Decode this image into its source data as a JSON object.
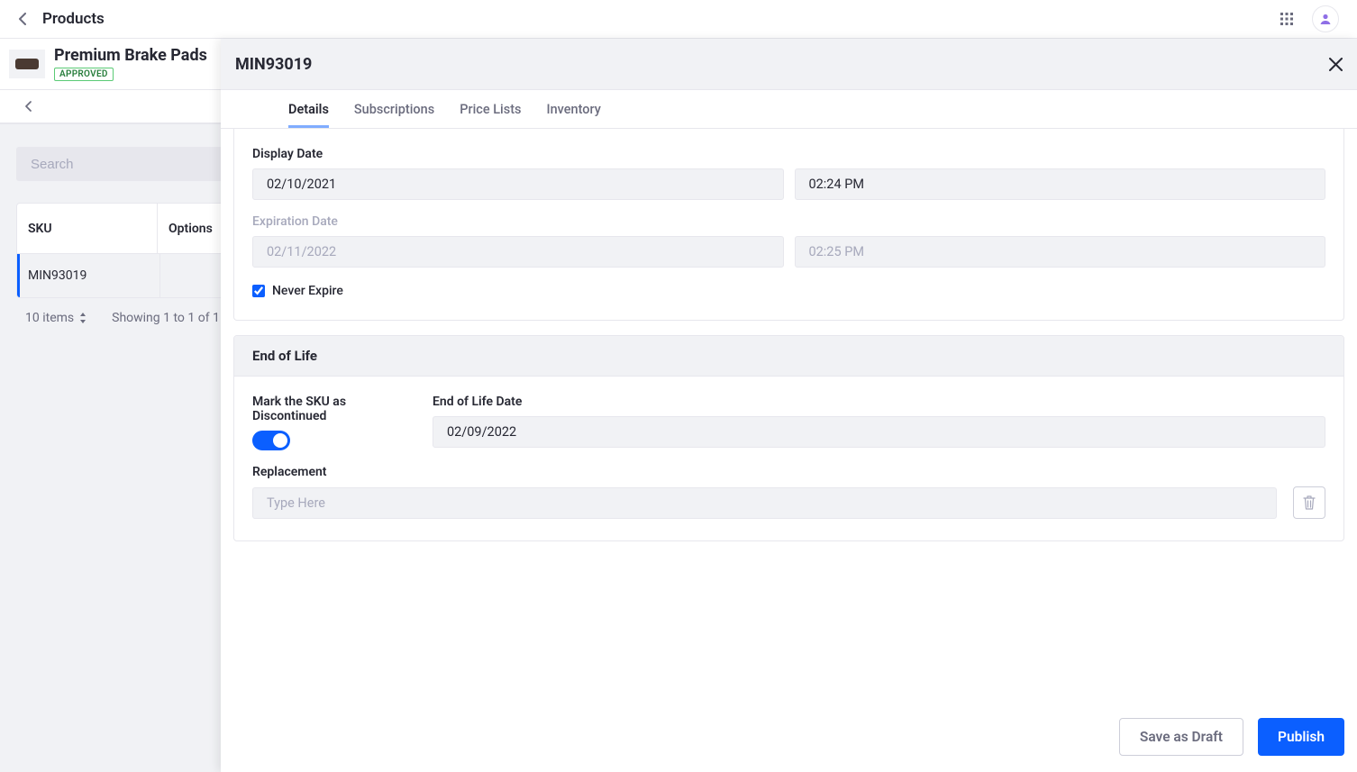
{
  "top": {
    "breadcrumb": "Products"
  },
  "product": {
    "name": "Premium Brake Pads",
    "status_badge": "APPROVED"
  },
  "left": {
    "search_placeholder": "Search",
    "columns": {
      "sku": "SKU",
      "options": "Options"
    },
    "row_sku": "MIN93019",
    "pager_items": "10 items",
    "pager_showing": "Showing 1 to 1 of 1"
  },
  "panel": {
    "title": "MIN93019",
    "tabs": {
      "details": "Details",
      "subscriptions": "Subscriptions",
      "price_lists": "Price Lists",
      "inventory": "Inventory"
    },
    "display_date": {
      "label": "Display Date",
      "date": "02/10/2021",
      "time": "02:24 PM"
    },
    "expiration_date": {
      "label": "Expiration Date",
      "date": "02/11/2022",
      "time": "02:25 PM"
    },
    "never_expire": {
      "label": "Never Expire",
      "checked": true
    },
    "eol": {
      "heading": "End of Life",
      "discontinued_label": "Mark the SKU as Discontinued",
      "discontinued_on": true,
      "eol_date_label": "End of Life Date",
      "eol_date": "02/09/2022",
      "replacement_label": "Replacement",
      "replacement_placeholder": "Type Here"
    },
    "actions": {
      "draft": "Save as Draft",
      "publish": "Publish"
    }
  }
}
